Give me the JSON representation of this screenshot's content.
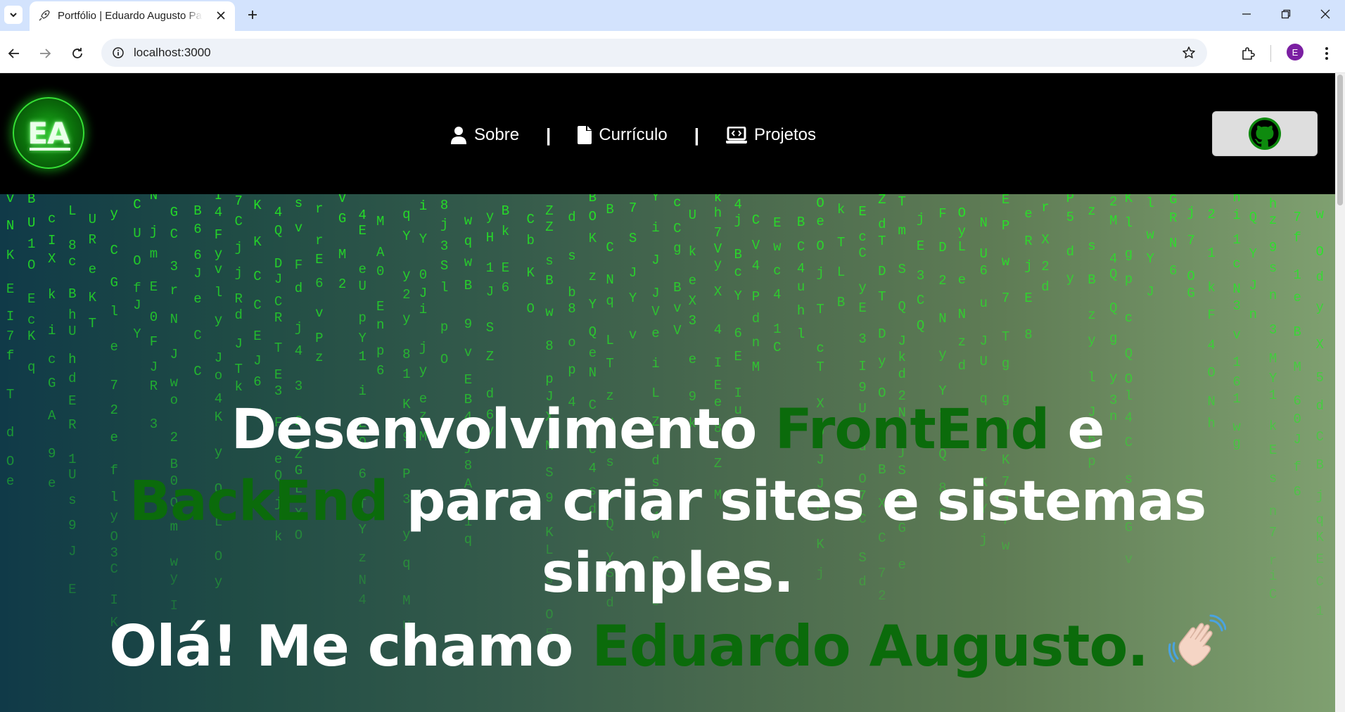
{
  "browser": {
    "tab_title": "Portfólio | Eduardo Augusto Pa",
    "url": "localhost:3000",
    "profile_initial": "E",
    "icons": [
      "tab-list-icon",
      "rocket-favicon-icon",
      "close-icon",
      "plus-icon",
      "minimize-icon",
      "restore-icon",
      "window-close-icon",
      "back-icon",
      "forward-icon",
      "reload-icon",
      "site-info-icon",
      "star-icon",
      "extensions-icon",
      "kebab-menu-icon"
    ]
  },
  "header": {
    "logo_text": "EA",
    "nav": [
      {
        "label": "Sobre",
        "icon": "user-icon"
      },
      {
        "label": "Currículo",
        "icon": "file-icon"
      },
      {
        "label": "Projetos",
        "icon": "laptop-code-icon"
      }
    ],
    "separator": "|",
    "github_icon": "github-icon"
  },
  "hero": {
    "line1_a": "Desenvolvimento ",
    "line1_b": "FrontEnd",
    "line1_c": " e",
    "line2_a": "BackEnd",
    "line2_b": " para criar sites e sistemas",
    "line3": "simples.",
    "line4_a": "Olá! Me chamo ",
    "line4_b": "Eduardo Augusto.",
    "wave_icon": "waving-hand-icon",
    "matrix_chars": "6 9 J c j J g C f l d E N U J E q s 4 T N Q 1 o X c J C w r e d V 7 M G V R I O v O 8 p X 3 j y 5 R I d B w f r m w M S Y u O C h 4 M K C H Q n e c 2 y L i S e E d P 6 B 4 O y k M 2 7 3 8 n y C E O 7 w n U 4 V B q E B e O y Z 9 T 4 K E R C A J i 2 j z B 7 U G s Y d k M N h v 1 Z 8 B D A 1 0 8 Y K z p L Y Z Q F q 3 k 0 b e l C"
  },
  "colors": {
    "accent_green": "#0b6b0b",
    "matrix_green": "#25e825",
    "header_bg": "#000000",
    "tabbar_bg": "#d3e3fd"
  }
}
